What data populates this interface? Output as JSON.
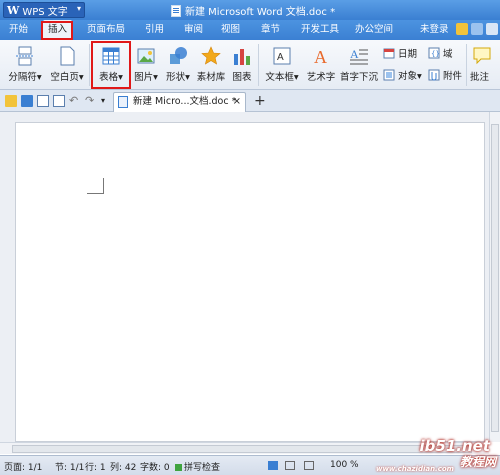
{
  "app": {
    "logo_letter": "W",
    "name": "WPS 文字",
    "menu_arrow": "▾"
  },
  "window": {
    "title": "新建 Microsoft Word 文档.doc *"
  },
  "menu": {
    "tabs": [
      "开始",
      "插入",
      "页面布局",
      "引用",
      "审阅",
      "视图",
      "章节",
      "开发工具",
      "办公空间"
    ],
    "active_tab": "插入",
    "login": "未登录"
  },
  "ribbon": {
    "page_break": "分隔符",
    "blank_page": "空白页",
    "table": "表格",
    "picture": "图片",
    "shape": "形状",
    "material": "素材库",
    "chart": "图表",
    "textbox": "文本框",
    "wordart": "艺术字",
    "dropcap": "首字下沉",
    "date": "日期",
    "field": "域",
    "object": "对象",
    "attachment": "附件",
    "comment": "批注",
    "dropdown_arrow": "▾"
  },
  "document_tab": {
    "name": "新建 Micro...文档.doc *",
    "close": "×",
    "new_tab": "+"
  },
  "status": {
    "page": "页面: 1/1",
    "section": "节: 1/1",
    "row": "行: 1",
    "column": "列: 42",
    "word_count": "字数: 0",
    "spell_check": "拼写检查",
    "zoom": "100 %"
  },
  "watermark": {
    "site": "ib51.net",
    "text": "教程网",
    "url": "www.chazidian.com"
  },
  "colors": {
    "title_bar": "#3a7fd2",
    "highlight": "#e01818",
    "ribbon": "#eef3fa"
  }
}
